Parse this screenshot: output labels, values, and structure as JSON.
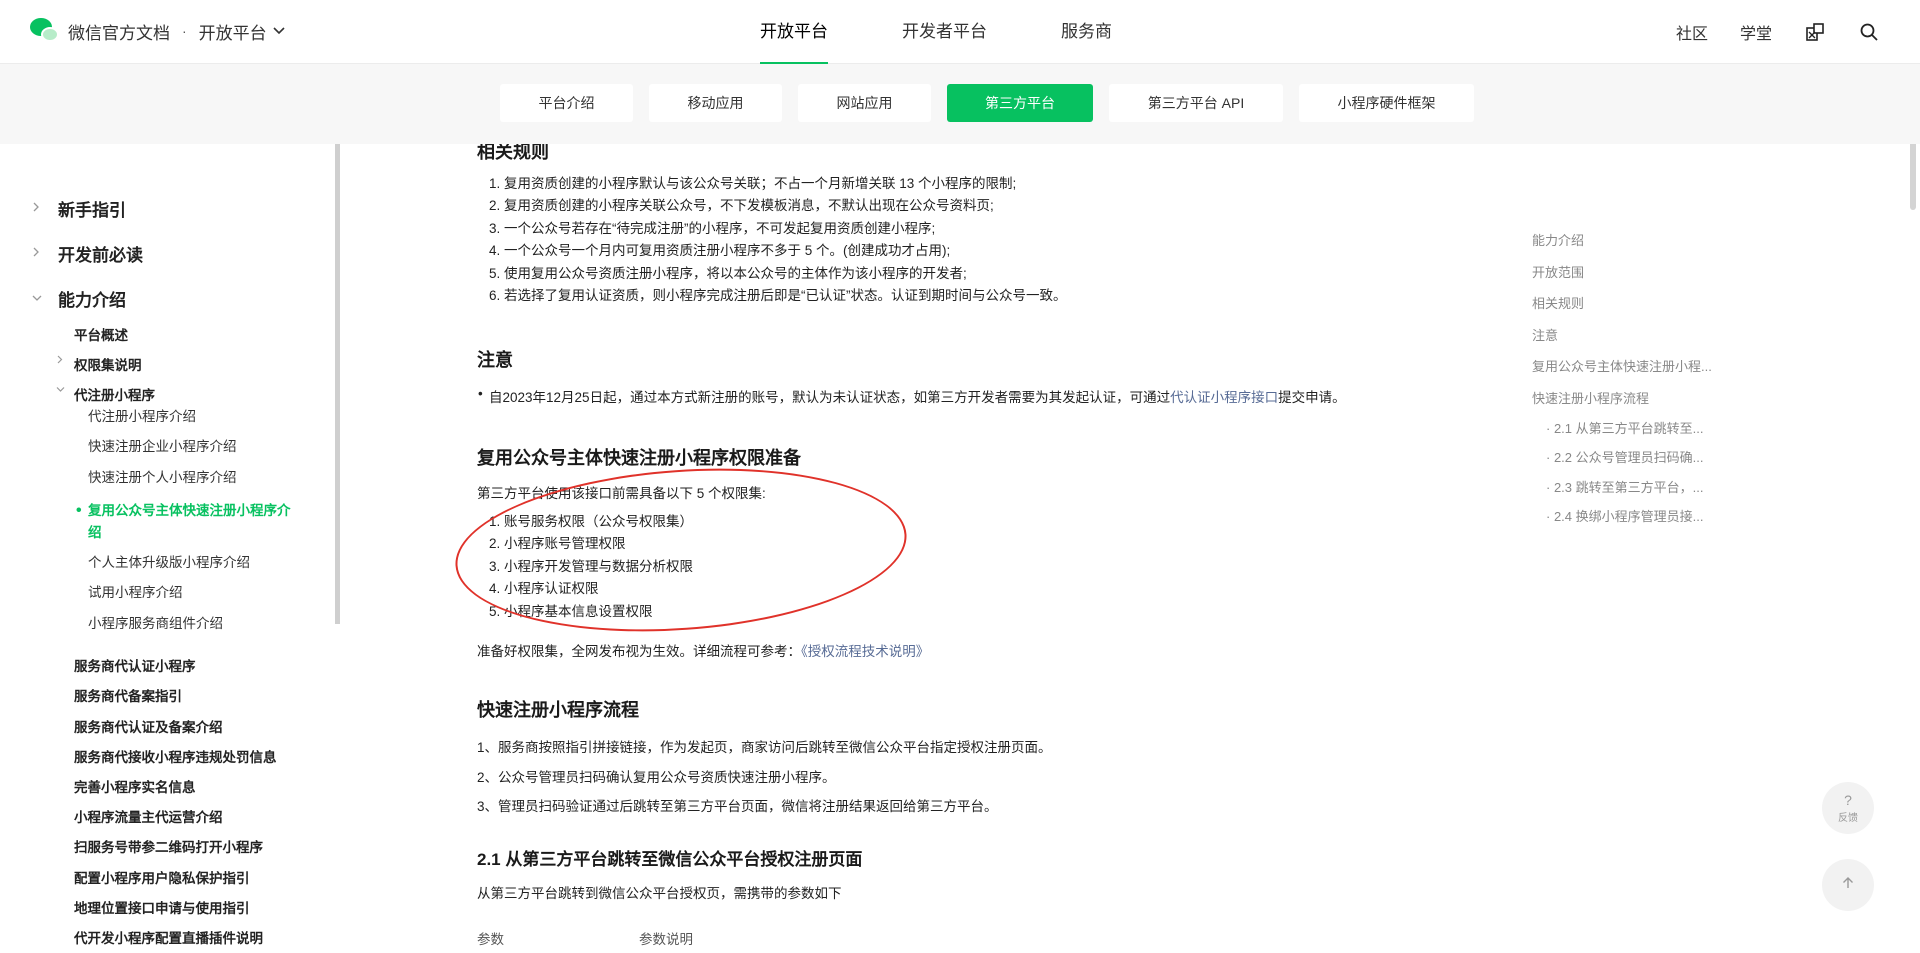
{
  "header": {
    "brand_title": "微信官方文档",
    "separator": "·",
    "platform": "开放平台",
    "nav": [
      "开放平台",
      "开发者平台",
      "服务商"
    ],
    "right_links": [
      "社区",
      "学堂"
    ]
  },
  "subtabs": [
    "平台介绍",
    "移动应用",
    "网站应用",
    "第三方平台",
    "第三方平台 API",
    "小程序硬件框架"
  ],
  "sidebar": {
    "top": [
      "新手指引",
      "开发前必读",
      "能力介绍"
    ],
    "l2a": [
      "平台概述",
      "权限集说明",
      "代注册小程序"
    ],
    "l3": [
      "代注册小程序介绍",
      "快速注册企业小程序介绍",
      "快速注册个人小程序介绍",
      "复用公众号主体快速注册小程序介",
      "绍",
      "个人主体升级版小程序介绍",
      "试用小程序介绍",
      "小程序服务商组件介绍"
    ],
    "l2b": [
      "服务商代认证小程序",
      "服务商代备案指引",
      "服务商代认证及备案介绍",
      "服务商代接收小程序违规处罚信息",
      "完善小程序实名信息",
      "小程序流量主代运营介绍",
      "扫服务号带参二维码打开小程序",
      "配置小程序用户隐私保护指引",
      "地理位置接口申请与使用指引",
      "代开发小程序配置直播插件说明"
    ]
  },
  "content": {
    "rules_heading": "相关规则",
    "rules": [
      "1. 复用资质创建的小程序默认与该公众号关联；不占一个月新增关联 13 个小程序的限制;",
      "2. 复用资质创建的小程序关联公众号，不下发模板消息，不默认出现在公众号资料页;",
      "3. 一个公众号若存在“待完成注册”的小程序，不可发起复用资质创建小程序;",
      "4. 一个公众号一个月内可复用资质注册小程序不多于 5 个。(创建成功才占用);",
      "5. 使用复用公众号资质注册小程序，将以本公众号的主体作为该小程序的开发者;",
      "6. 若选择了复用认证资质，则小程序完成注册后即是“已认证”状态。认证到期时间与公众号一致。"
    ],
    "note_heading": "注意",
    "note_text": "自2023年12月25日起，通过本方式新注册的账号，默认为未认证状态，如第三方开发者需要为其发起认证，可通过",
    "note_link": "代认证小程序接口",
    "note_tail": "提交申请。",
    "perm_heading": "复用公众号主体快速注册小程序权限准备",
    "perm_intro": "第三方平台使用该接口前需具备以下 5 个权限集:",
    "perms": [
      "1. 账号服务权限（公众号权限集）",
      "2. 小程序账号管理权限",
      "3. 小程序开发管理与数据分析权限",
      "4. 小程序认证权限",
      "5. 小程序基本信息设置权限"
    ],
    "perm_after": "准备好权限集，全网发布视为生效。详细流程可参考：",
    "perm_link": "《授权流程技术说明》",
    "flow_heading": "快速注册小程序流程",
    "flow": [
      "1、服务商按照指引拼接链接，作为发起页，商家访问后跳转至微信公众平台指定授权注册页面。",
      "2、公众号管理员扫码确认复用公众号资质快速注册小程序。",
      "3、管理员扫码验证通过后跳转至第三方平台页面，微信将注册结果返回给第三方平台。"
    ],
    "sec21_heading": "2.1 从第三方平台跳转至微信公众平台授权注册页面",
    "sec21_text": "从第三方平台跳转到微信公众平台授权页，需携带的参数如下",
    "table_head": [
      "参数",
      "参数说明"
    ]
  },
  "toc": [
    "能力介绍",
    "开放范围",
    "相关规则",
    "注意",
    "复用公众号主体快速注册小程...",
    "快速注册小程序流程",
    "· 2.1 从第三方平台跳转至...",
    "· 2.2 公众号管理员扫码确...",
    "· 2.3 跳转至第三方平台，...",
    "· 2.4 换绑小程序管理员接..."
  ],
  "feedback": {
    "icon": "?",
    "label": "反馈"
  },
  "colors": {
    "accent": "#07c160",
    "link": "#576b95",
    "annotation": "#e0322a"
  }
}
